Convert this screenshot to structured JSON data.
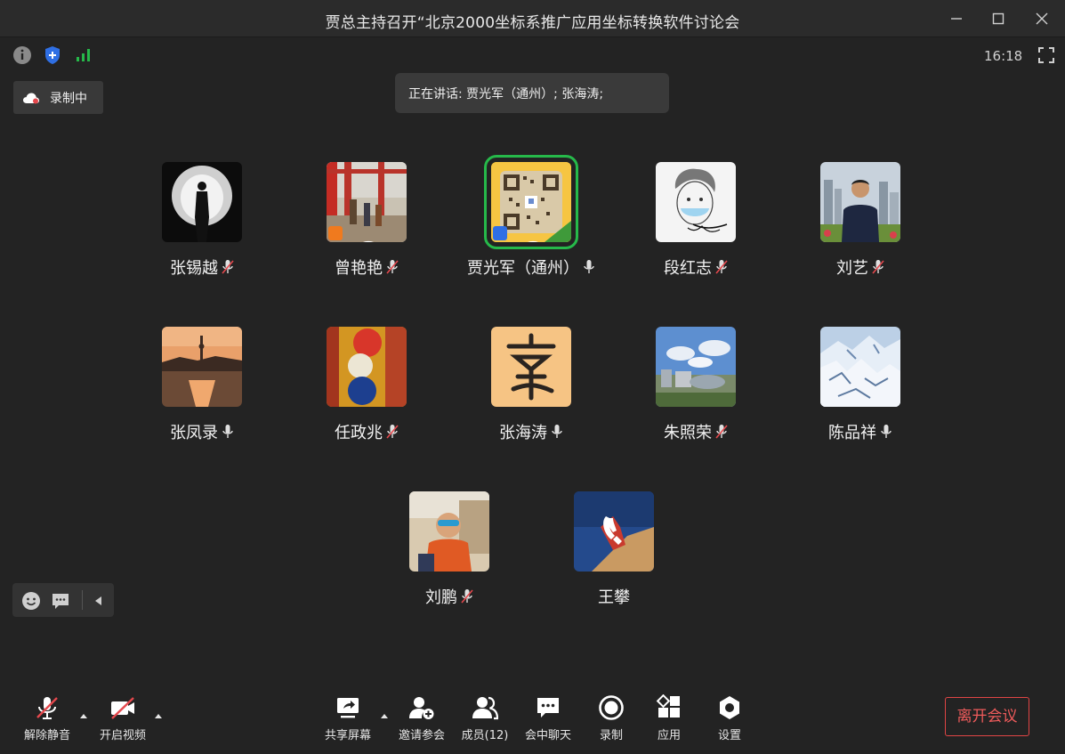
{
  "window": {
    "title": "贾总主持召开“北京2000坐标系推广应用坐标转换软件讨论会",
    "controls": [
      "minimize-icon",
      "maximize-icon",
      "close-icon"
    ]
  },
  "status": {
    "icons": [
      "info-icon",
      "shield-icon",
      "signal-icon"
    ],
    "time": "16:18"
  },
  "recording": {
    "label": "录制中"
  },
  "speaking": {
    "text": "正在讲话: 贾光军（通州）; 张海涛;"
  },
  "participants": [
    {
      "name": "张锡越",
      "muted": true
    },
    {
      "name": "曾艳艳",
      "muted": true,
      "host_badge": true
    },
    {
      "name": "贾光军（通州）",
      "muted": false,
      "active_speaker": true,
      "host_badge": true
    },
    {
      "name": "段红志",
      "muted": true
    },
    {
      "name": "刘艺",
      "muted": true
    },
    {
      "name": "张凤录",
      "muted": false
    },
    {
      "name": "任政兆",
      "muted": true
    },
    {
      "name": "张海涛",
      "muted": false
    },
    {
      "name": "朱照荣",
      "muted": true
    },
    {
      "name": "陈品祥",
      "muted": false
    },
    {
      "name": "刘鹏",
      "muted": true
    },
    {
      "name": "王攀",
      "phone": true
    }
  ],
  "toolbar": {
    "unmute": "解除静音",
    "start_video": "开启视频",
    "share_screen": "共享屏幕",
    "invite": "邀请参会",
    "members": "成员(12)",
    "chat": "会中聊天",
    "record": "录制",
    "apps": "应用",
    "settings": "设置",
    "leave": "离开会议"
  },
  "colors": {
    "background": "#232323",
    "active_speaker": "#26b94a",
    "leave": "#e04545",
    "mute_slash": "#e5484d",
    "signal": "#26b94a",
    "shield": "#2f6fe4"
  }
}
